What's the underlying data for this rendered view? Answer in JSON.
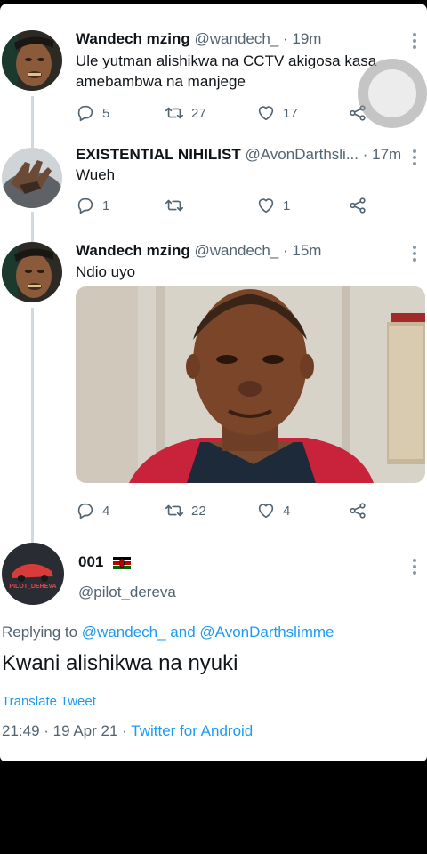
{
  "tweets": [
    {
      "author": "Wandech mzing",
      "handle": "@wandech_",
      "time": "· 19m",
      "text": "Ule yutman alishikwa na CCTV akigosa kasa amebambwa na manjege",
      "replies": "5",
      "retweets": "27",
      "likes": "17"
    },
    {
      "author": "EXISTENTIAL NIHILIST",
      "handle": "@AvonDarthsli...",
      "time": "· 17m",
      "text": "Wueh",
      "replies": "1",
      "retweets": "",
      "likes": "1"
    },
    {
      "author": "Wandech mzing",
      "handle": "@wandech_",
      "time": "· 15m",
      "text": "Ndio uyo",
      "replies": "4",
      "retweets": "22",
      "likes": "4"
    }
  ],
  "main_tweet": {
    "author": "001",
    "handle": "@pilot_dereva",
    "avatar_text": "PILOT_DEREVA",
    "replying_label": "Replying to",
    "replying_to_1": "@wandech_",
    "replying_and": "and",
    "replying_to_2": "@AvonDarthslimme",
    "text": "Kwani alishikwa na nyuki",
    "translate": "Translate Tweet",
    "timestamp": "21:49 · 19 Apr 21 ·",
    "source": "Twitter for Android"
  },
  "icons": {
    "reply": "reply-icon",
    "retweet": "retweet-icon",
    "like": "heart-icon",
    "share": "share-icon",
    "more": "more-vertical-icon",
    "flag": "kenya-flag-icon"
  },
  "colors": {
    "link": "#1d9bf0",
    "meta": "#536471",
    "thread_line": "#cfd9de"
  }
}
